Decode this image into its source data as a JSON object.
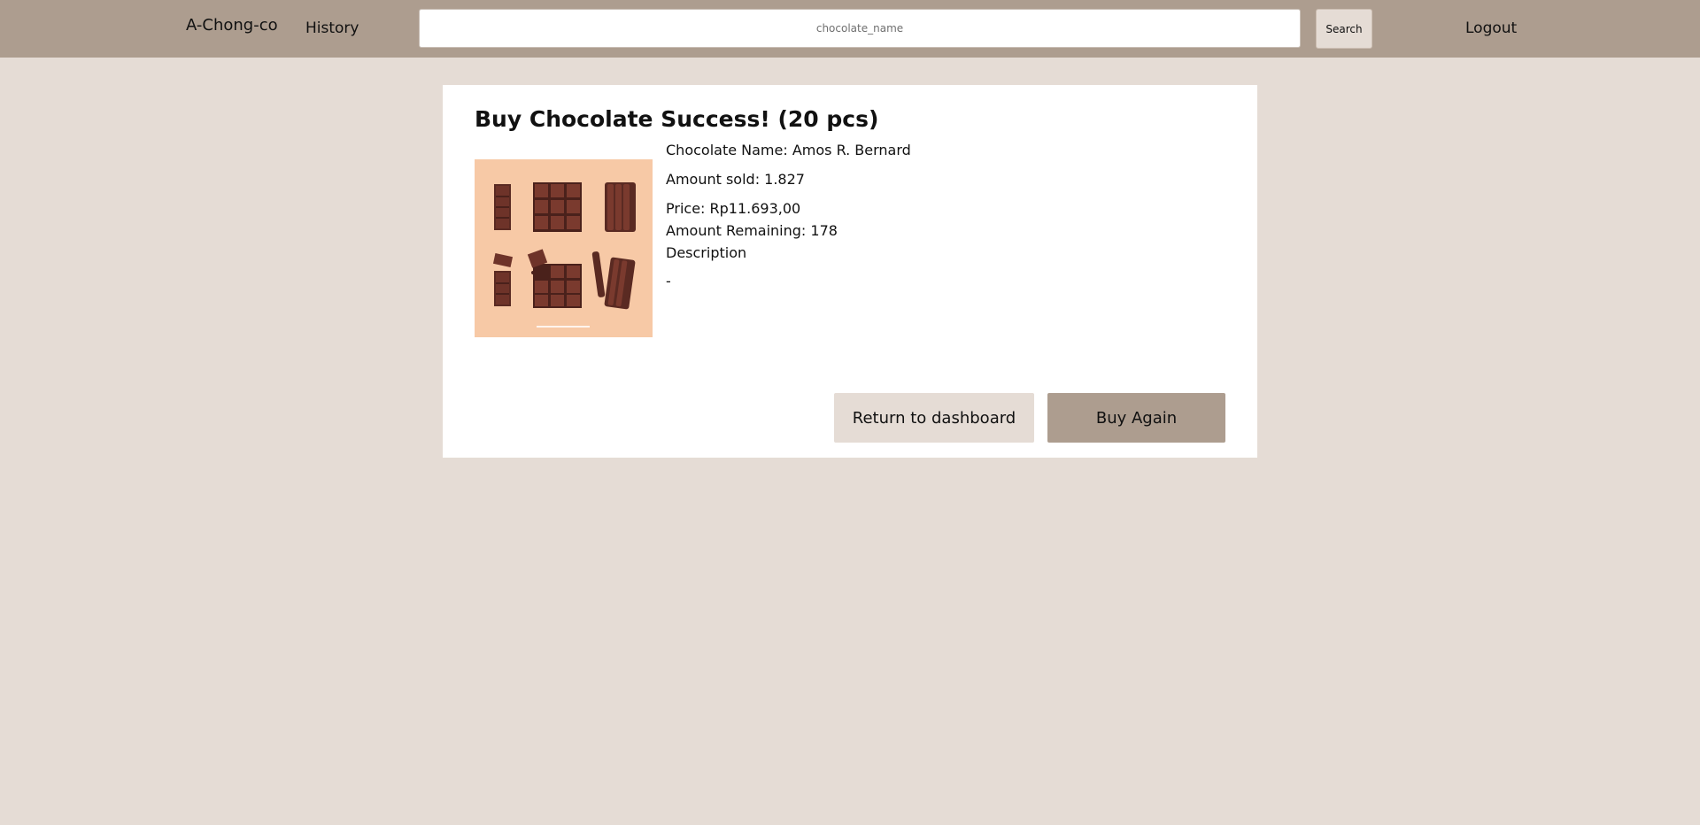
{
  "navbar": {
    "brand": "A-Chong-co",
    "history_label": "History",
    "search_placeholder": "chocolate_name",
    "search_value": "",
    "search_button_label": "Search",
    "logout_label": "Logout",
    "background_color": "#ad9d8f"
  },
  "page": {
    "background_color": "#e5dcd5"
  },
  "card": {
    "title": "Buy Chocolate Success! (20 pcs)",
    "image_subject": "chocolate-bars-illustration",
    "chocolate_name_line": "Chocolate Name: Amos R. Bernard",
    "amount_sold_line": "Amount sold: 1.827",
    "price_line": "Price: Rp11.693,00",
    "amount_remaining_line": "Amount Remaining: 178",
    "description_label": "Description",
    "description_text": "-",
    "return_button_label": "Return to dashboard",
    "buy_again_button_label": "Buy Again"
  }
}
